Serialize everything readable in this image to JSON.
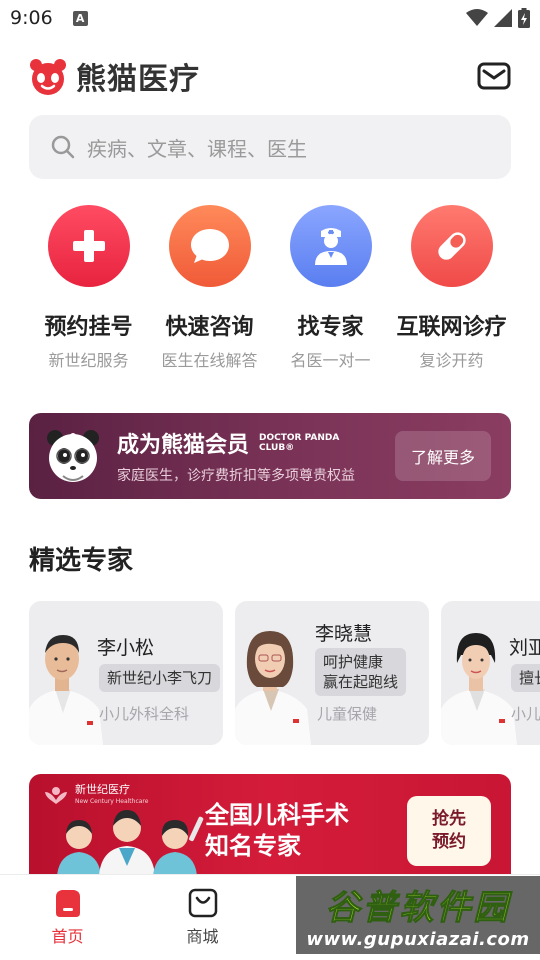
{
  "status_bar": {
    "time": "9:06",
    "notif_letter": "A"
  },
  "header": {
    "app_name": "熊猫医疗",
    "logo_icon": "panda-logo-icon",
    "mail_icon": "mail-icon"
  },
  "search": {
    "placeholder": "疾病、文章、课程、医生"
  },
  "quick_actions": [
    {
      "title": "预约挂号",
      "subtitle": "新世纪服务",
      "icon": "plus-icon",
      "color": "#f0354f"
    },
    {
      "title": "快速咨询",
      "subtitle": "医生在线解答",
      "icon": "chat-bubble-icon",
      "color": "#f66e45"
    },
    {
      "title": "找专家",
      "subtitle": "名医一对一",
      "icon": "doctor-icon",
      "color": "#6a8cf5"
    },
    {
      "title": "互联网诊疗",
      "subtitle": "复诊开药",
      "icon": "pill-icon",
      "color": "#f55e55"
    }
  ],
  "member_banner": {
    "title": "成为熊猫会员",
    "en_line1": "DOCTOR PANDA",
    "en_line2": "CLUB®",
    "subtitle": "家庭医生，诊疗费折扣等多项尊贵权益",
    "button": "了解更多"
  },
  "experts_section": {
    "title": "精选专家",
    "experts": [
      {
        "name": "李小松",
        "tag": "新世纪小李飞刀",
        "dept": "小儿外科全科"
      },
      {
        "name": "李晓慧",
        "tag_line1": "呵护健康",
        "tag_line2": "赢在起跑线",
        "dept": "儿童保健"
      },
      {
        "name": "刘亚",
        "tag": "擅长",
        "dept": "小儿"
      }
    ]
  },
  "promo_banner": {
    "brand": "新世纪医疗",
    "brand_en": "New Century Healthcare",
    "title_line1": "全国儿科手术",
    "title_line2": "知名专家",
    "button_line1": "抢先",
    "button_line2": "预约"
  },
  "bottom_nav": [
    {
      "label": "首页",
      "icon": "home-icon",
      "active": true
    },
    {
      "label": "商城",
      "icon": "shopping-bag-icon",
      "active": false
    },
    {
      "label": "",
      "icon": "",
      "active": false
    },
    {
      "label": "",
      "icon": "",
      "active": false
    }
  ],
  "watermark": {
    "title": "谷普软件园",
    "url": "www.gupuxiazai.com"
  },
  "colors": {
    "brand_red": "#e8333c",
    "member_bg": "#6a2a4c",
    "promo_red": "#c81634"
  }
}
